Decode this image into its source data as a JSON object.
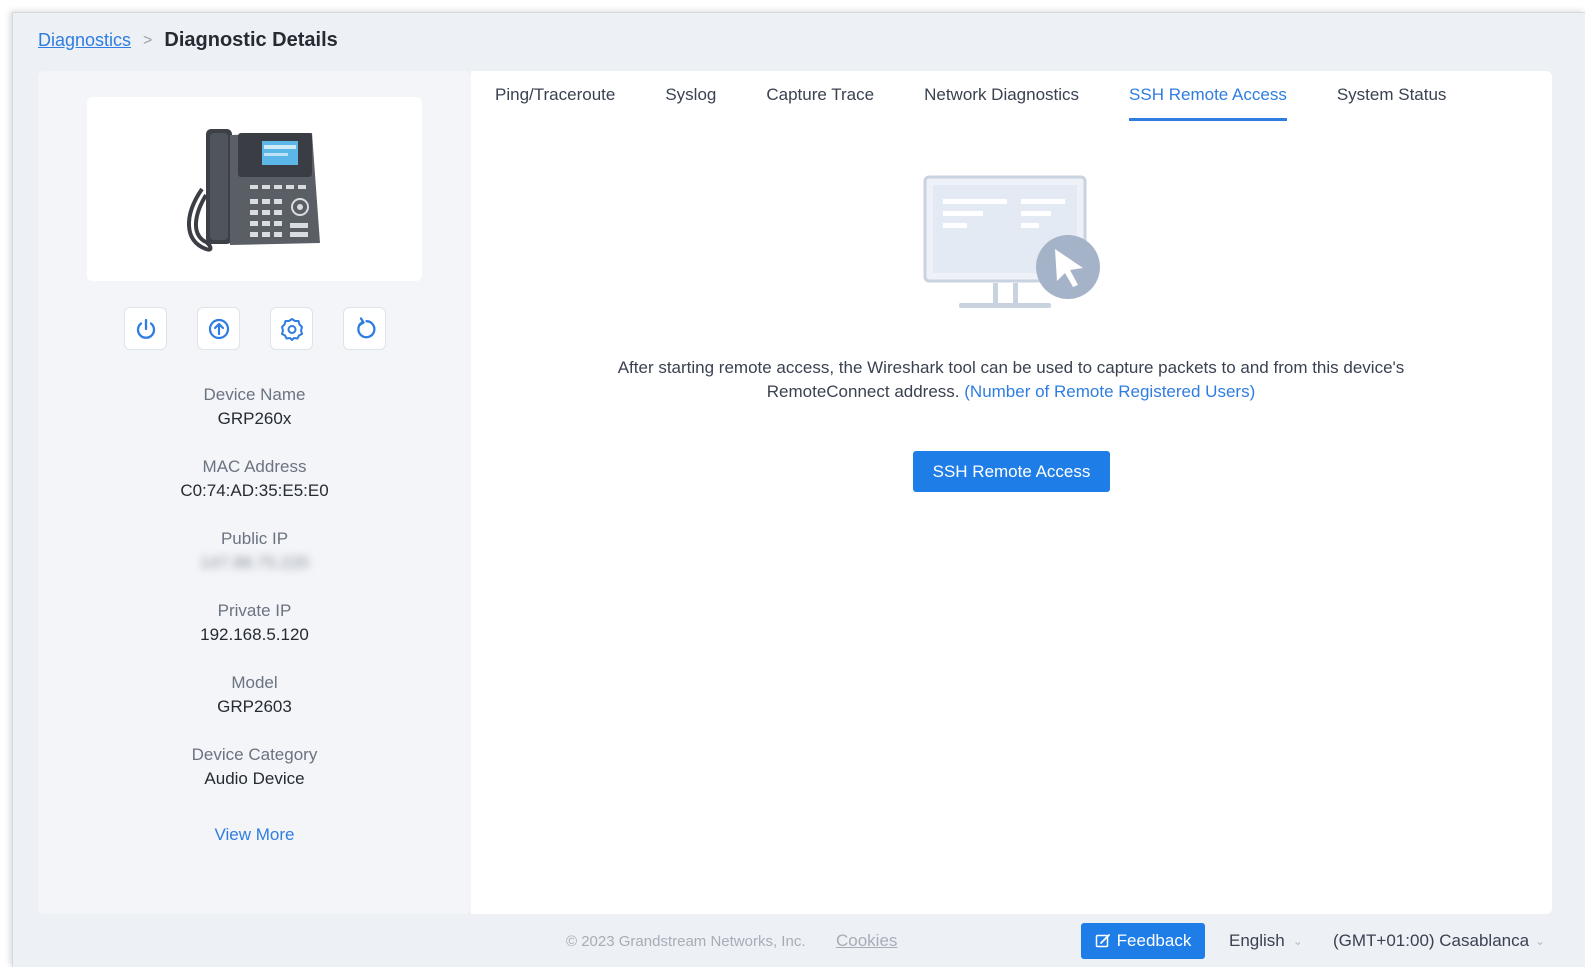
{
  "breadcrumb": {
    "parent": "Diagnostics",
    "separator": ">",
    "current": "Diagnostic Details"
  },
  "device": {
    "image_icon": "desk-phone-icon",
    "actions": [
      {
        "name": "power-button",
        "icon": "power-icon"
      },
      {
        "name": "upgrade-button",
        "icon": "upload-icon"
      },
      {
        "name": "settings-button",
        "icon": "gear-icon"
      },
      {
        "name": "refresh-button",
        "icon": "refresh-icon"
      }
    ],
    "info": [
      {
        "label": "Device Name",
        "value": "GRP260x"
      },
      {
        "label": "MAC Address",
        "value": "C0:74:AD:35:E5:E0"
      },
      {
        "label": "Public IP",
        "value": "147.88.75.220"
      },
      {
        "label": "Private IP",
        "value": "192.168.5.120"
      },
      {
        "label": "Model",
        "value": "GRP2603"
      },
      {
        "label": "Device Category",
        "value": "Audio Device"
      }
    ],
    "view_more": "View More"
  },
  "tabs": [
    {
      "label": "Ping/Traceroute",
      "active": false
    },
    {
      "label": "Syslog",
      "active": false
    },
    {
      "label": "Capture Trace",
      "active": false
    },
    {
      "label": "Network Diagnostics",
      "active": false
    },
    {
      "label": "SSH Remote Access",
      "active": true
    },
    {
      "label": "System Status",
      "active": false
    }
  ],
  "ssh": {
    "illustration_icon": "remote-monitor-icon",
    "description": "After starting remote access, the Wireshark tool can be used to capture packets to and from this device's RemoteConnect address. ",
    "link": "(Number of Remote Registered Users)",
    "button": "SSH Remote Access"
  },
  "footer": {
    "copyright": "© 2023 Grandstream Networks, Inc.",
    "cookies": "Cookies",
    "feedback": "Feedback",
    "language": "English",
    "timezone": "(GMT+01:00) Casablanca"
  },
  "colors": {
    "accent": "#1f7de8",
    "link": "#2f7de1",
    "page_bg": "#edf0f5"
  }
}
